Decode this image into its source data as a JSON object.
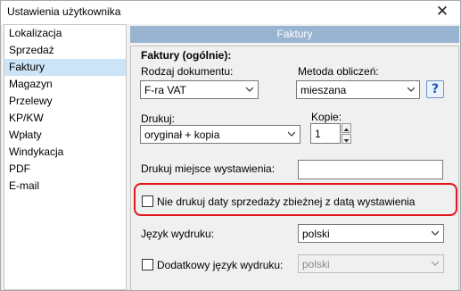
{
  "window": {
    "title": "Ustawienia użytkownika",
    "close_glyph": "✕"
  },
  "sidebar": {
    "items": [
      {
        "label": "Lokalizacja"
      },
      {
        "label": "Sprzedaż"
      },
      {
        "label": "Faktury",
        "selected": true
      },
      {
        "label": "Magazyn"
      },
      {
        "label": "Przelewy"
      },
      {
        "label": "KP/KW"
      },
      {
        "label": "Wpłaty"
      },
      {
        "label": "Windykacja"
      },
      {
        "label": "PDF"
      },
      {
        "label": "E-mail"
      }
    ]
  },
  "panel": {
    "header": "Faktury",
    "group_title": "Faktury (ogólnie):",
    "doc_type": {
      "label": "Rodzaj dokumentu:",
      "value": "F-ra VAT"
    },
    "calc_method": {
      "label": "Metoda obliczeń:",
      "value": "mieszana"
    },
    "help_glyph": "?",
    "print": {
      "label": "Drukuj:",
      "value": "oryginał + kopia"
    },
    "copies": {
      "label": "Kopie:",
      "value": "1"
    },
    "print_place": {
      "label": "Drukuj miejsce wystawienia:",
      "value": ""
    },
    "no_sale_date": {
      "label": "Nie drukuj daty sprzedaży zbieżnej z datą wystawienia",
      "checked": false
    },
    "print_lang": {
      "label": "Język wydruku:",
      "value": "polski"
    },
    "extra_lang": {
      "label": "Dodatkowy język wydruku:",
      "value": "polski",
      "checked": false
    }
  },
  "colors": {
    "header_bar": "#99b4d1",
    "selected_item": "#cce4f7",
    "highlight_border": "#e0161c"
  }
}
